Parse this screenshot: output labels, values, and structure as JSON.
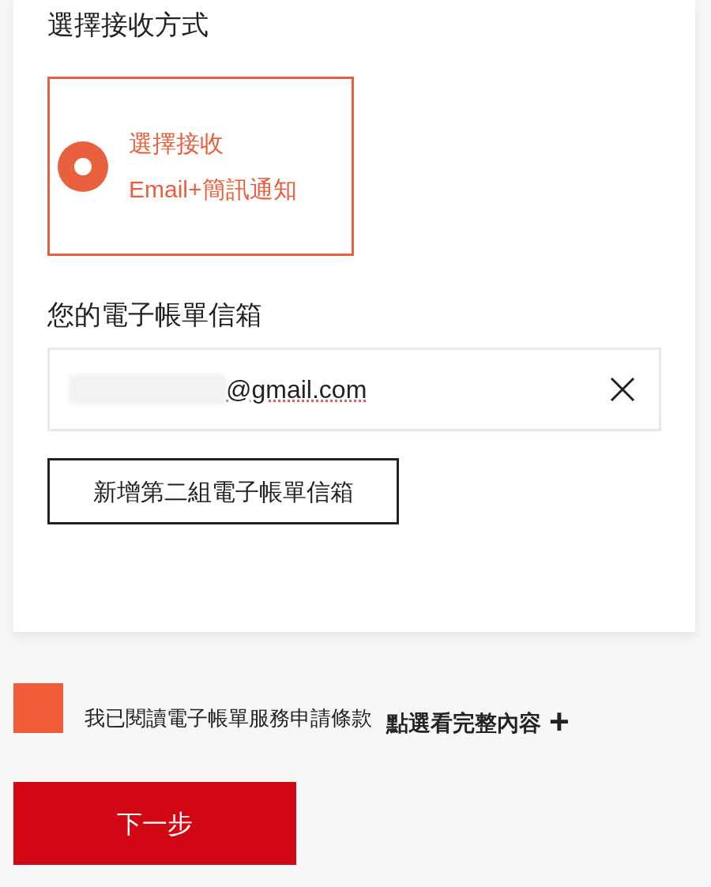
{
  "section_title": "選擇接收方式",
  "options": [
    {
      "lines": [
        "選擇接收",
        "Email+簡訊通知"
      ],
      "selected": true
    }
  ],
  "email_heading": "您的電子帳單信箱",
  "email_field": {
    "value": "@gmail.com"
  },
  "add_email_button": "新增第二組電子帳單信箱",
  "terms": {
    "checked": false,
    "text": "我已閱讀電子帳單服務申請條款",
    "link": "點選看完整內容",
    "expand_icon": "+"
  },
  "next_button": "下一步"
}
